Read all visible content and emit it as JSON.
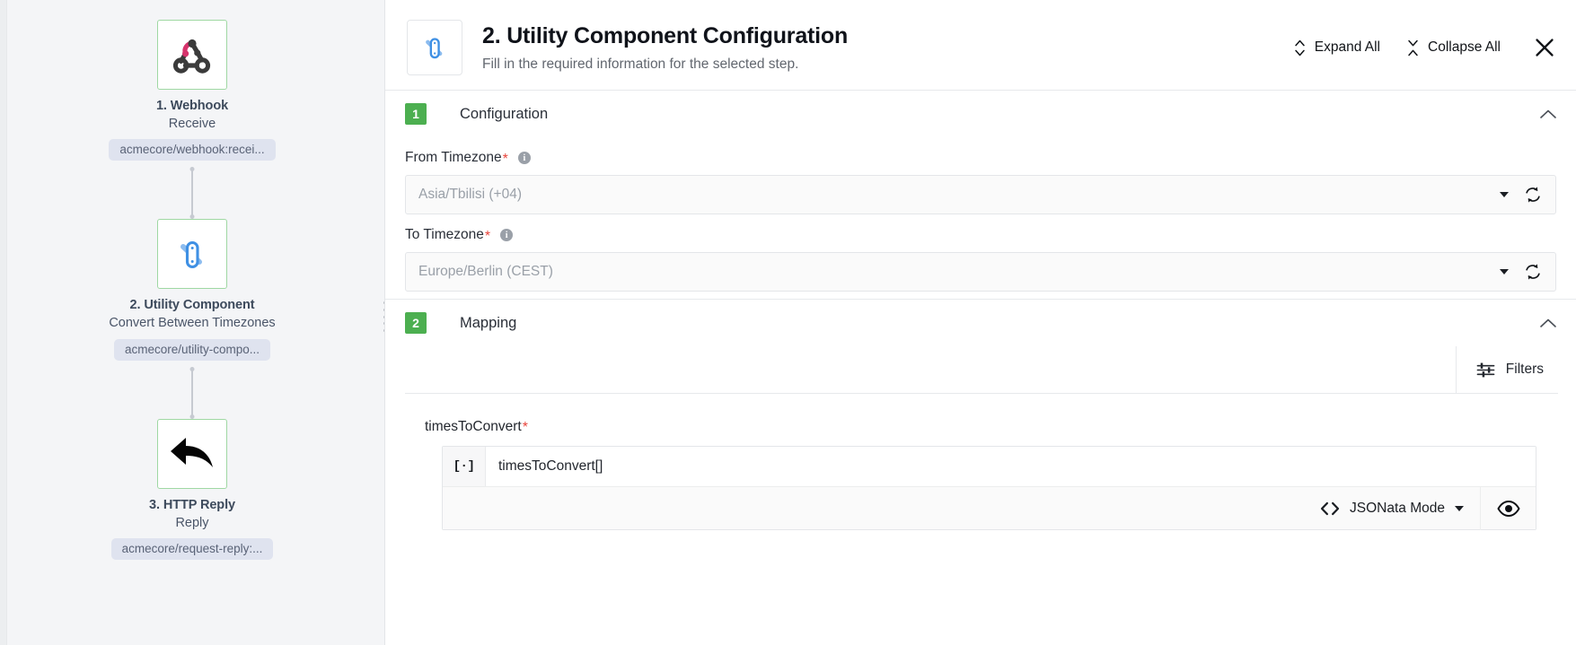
{
  "flow": {
    "nodes": [
      {
        "title": "1. Webhook",
        "subtitle": "Receive",
        "chip": "acmecore/webhook:recei...",
        "icon": "webhook-icon"
      },
      {
        "title": "2. Utility Component",
        "subtitle": "Convert Between Timezones",
        "chip": "acmecore/utility-compo...",
        "icon": "swiss-army-knife-icon"
      },
      {
        "title": "3. HTTP Reply",
        "subtitle": "Reply",
        "chip": "acmecore/request-reply:...",
        "icon": "reply-arrow-icon"
      }
    ]
  },
  "header": {
    "icon": "swiss-army-knife-icon",
    "title": "2. Utility Component Configuration",
    "subtitle": "Fill in the required information for the selected step.",
    "expand_all_label": "Expand All",
    "collapse_all_label": "Collapse All",
    "expand_all_icon": "expand-vertical-icon",
    "collapse_all_icon": "collapse-vertical-icon",
    "close_icon": "close-icon"
  },
  "sections": {
    "configuration": {
      "badge": "1",
      "label": "Configuration",
      "toggle_icon": "chevron-up-icon",
      "fields": [
        {
          "label": "From Timezone",
          "required": "*",
          "info_icon": "info-icon",
          "value": "Asia/Tbilisi (+04)",
          "placeholder": "Asia/Tbilisi (+04)",
          "dropdown_icon": "chevron-down-icon",
          "refresh_icon": "refresh-icon"
        },
        {
          "label": "To Timezone",
          "required": "*",
          "info_icon": "info-icon",
          "value": "Europe/Berlin (CEST)",
          "placeholder": "Europe/Berlin (CEST)",
          "dropdown_icon": "chevron-down-icon",
          "refresh_icon": "refresh-icon"
        }
      ]
    },
    "mapping": {
      "badge": "2",
      "label": "Mapping",
      "toggle_icon": "chevron-up-icon",
      "filters_label": "Filters",
      "filters_icon": "tune-sliders-icon",
      "field": {
        "label": "timesToConvert",
        "required": "*",
        "type_glyph": "[·]",
        "expression": "timesToConvert[]",
        "mode_label": "JSONata Mode",
        "mode_icon": "code-brackets-icon",
        "mode_caret_icon": "chevron-down-icon",
        "preview_icon": "eye-icon"
      }
    }
  },
  "colors": {
    "badge_green": "#4caf50",
    "node_border_green": "#9fd8a3",
    "required_red": "#e8453c",
    "chip_bg": "#dfe3ef",
    "panel_bg": "#f4f5f7"
  }
}
